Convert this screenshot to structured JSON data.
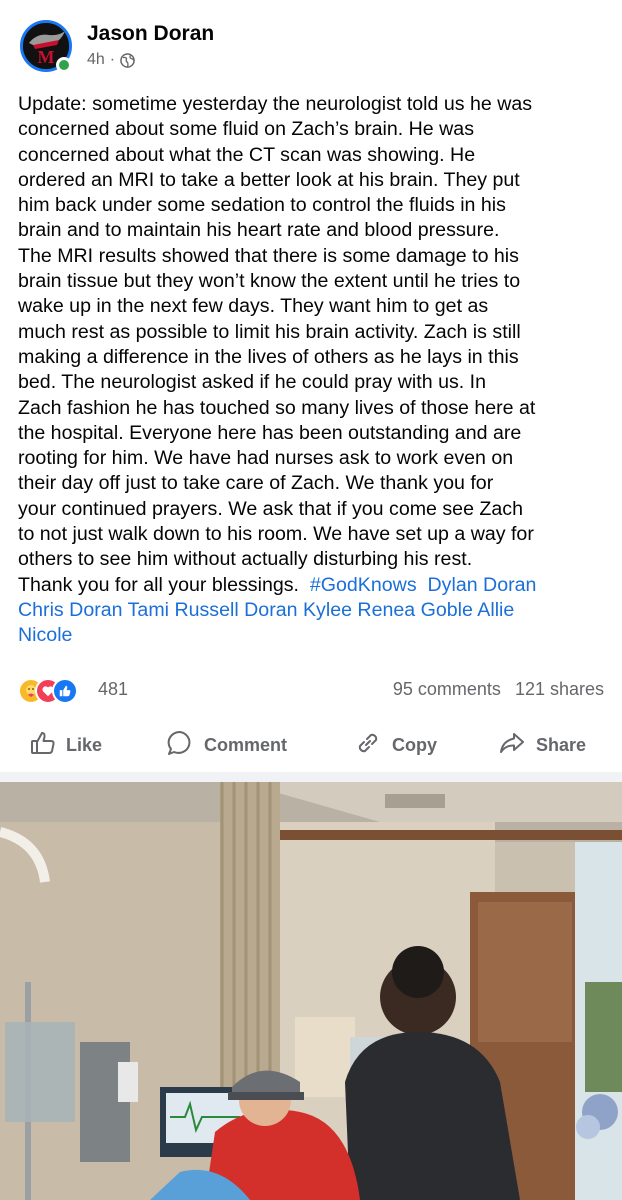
{
  "post": {
    "author": "Jason Doran",
    "time": "4h",
    "separator": "·",
    "audience_icon": "globe-icon",
    "text_lines": [
      "Update: sometime yesterday the neurologist told us he was",
      "concerned about some fluid on Zach’s brain. He was",
      "concerned about what the CT scan was showing. He",
      "ordered an MRI to take a better look at his brain. They put",
      "him back under some sedation to control the fluids in his",
      "brain and to maintain his heart rate and blood pressure.",
      "The MRI results showed that there is some damage to his",
      "brain tissue but they won’t know the extent until he tries to",
      "wake up in the next few days. They want him to get as",
      "much rest as possible to limit his brain activity.  Zach is still",
      "making a difference in the lives of others as he lays in this",
      "bed. The neurologist asked if he could pray with us. In",
      "Zach fashion he has touched so many lives of those here at",
      "the hospital. Everyone here has been outstanding and are",
      "rooting for him. We have had nurses ask to work even on",
      "their day off just to take care of Zach. We thank you for",
      "your continued prayers. We ask that if you come see Zach",
      "to not just walk down to his room. We have set up a way for",
      "others to see him without actually disturbing his rest."
    ],
    "closing_text": "Thank you for all your blessings.",
    "hashtag": "#GodKnows",
    "tag_dylan": "Dylan Doran",
    "tag_chris": "Chris Doran",
    "tag_tami": "Tami Russell Doran",
    "tag_kylee": "Kylee Renea Goble",
    "tag_allie_first": "Allie",
    "tag_allie_last": "Nicole"
  },
  "reactions": {
    "icons": [
      "care-icon",
      "love-icon",
      "like-icon"
    ],
    "count": "481",
    "comments": "95 comments",
    "shares": "121 shares"
  },
  "actions": {
    "like": "Like",
    "comment": "Comment",
    "copy": "Copy",
    "share": "Share"
  },
  "colors": {
    "link": "#1a6fd8",
    "secondary": "#65676b",
    "online": "#31a24c",
    "brand_blue": "#1877f2"
  }
}
